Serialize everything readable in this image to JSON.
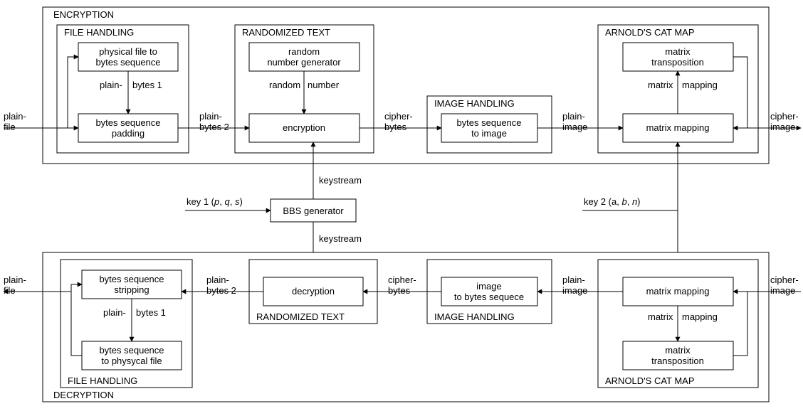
{
  "enc": {
    "title": "ENCRYPTION",
    "file_handling": {
      "title": "FILE HANDLING",
      "box1_l1": "physical file to",
      "box1_l2": "bytes sequence",
      "box2_l1": "bytes sequence",
      "box2_l2": "padding",
      "edge_l1": "plain-",
      "edge_l2": "bytes 1"
    },
    "randomized_text": {
      "title": "RANDOMIZED TEXT",
      "box1_l1": "random",
      "box1_l2": "number generator",
      "box2": "encryption",
      "edge_l1": "random",
      "edge_l2": "number"
    },
    "image_handling": {
      "title": "IMAGE HANDLING",
      "box1_l1": "bytes sequence",
      "box1_l2": "to image"
    },
    "arnold": {
      "title": "ARNOLD'S CAT MAP",
      "box1_l1": "matrix",
      "box1_l2": "transposition",
      "box2": "matrix mapping",
      "edge_l1": "matrix",
      "edge_l2": "mapping"
    }
  },
  "dec": {
    "title": "DECRYPTION",
    "file_handling": {
      "title": "FILE HANDLING",
      "box1_l1": "bytes sequence",
      "box1_l2": "stripping",
      "box2_l1": "bytes sequence",
      "box2_l2": "to physycal file",
      "edge_l1": "plain-",
      "edge_l2": "bytes 1"
    },
    "randomized_text": {
      "title": "RANDOMIZED TEXT",
      "box1": "decryption"
    },
    "image_handling": {
      "title": "IMAGE HANDLING",
      "box1_l1": "image",
      "box1_l2": "to bytes sequece"
    },
    "arnold": {
      "title": "ARNOLD'S CAT MAP",
      "box1": "matrix mapping",
      "box2_l1": "matrix",
      "box2_l2": "transposition",
      "edge_l1": "matrix",
      "edge_l2": "mapping"
    }
  },
  "middle": {
    "bbs": "BBS generator",
    "keystream": "keystream",
    "key1_pre": "key 1 (",
    "key1_post": ")",
    "key1_p": "p",
    "key1_q": "q",
    "key1_s": "s",
    "key2_pre": "key 2 (a, ",
    "key2_post": ")",
    "key2_b": "b",
    "key2_n": "n"
  },
  "io": {
    "plain_file_l1": "plain-",
    "plain_file_l2": "file",
    "plain_bytes2_l1": "plain-",
    "plain_bytes2_l2": "bytes 2",
    "cipher_bytes_l1": "cipher-",
    "cipher_bytes_l2": "bytes",
    "plain_image_l1": "plain-",
    "plain_image_l2": "image",
    "cipher_image_l1": "cipher-",
    "cipher_image_l2": "image"
  }
}
